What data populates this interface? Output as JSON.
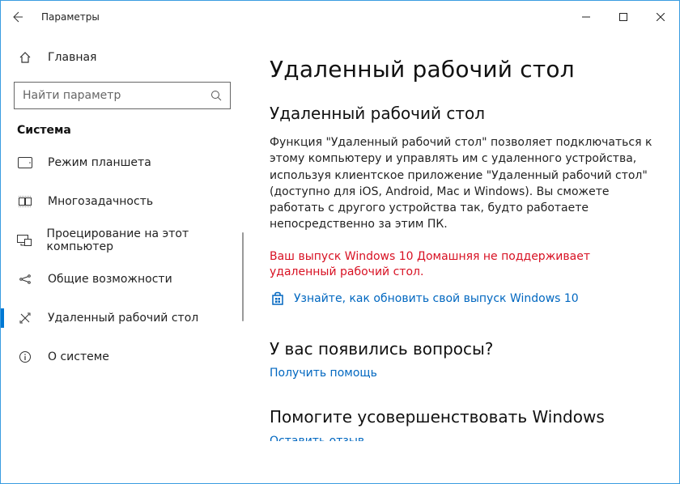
{
  "titlebar": {
    "app_title": "Параметры"
  },
  "sidebar": {
    "home_label": "Главная",
    "search_placeholder": "Найти параметр",
    "group_label": "Система",
    "items": [
      {
        "label": "Режим планшета"
      },
      {
        "label": "Многозадачность"
      },
      {
        "label": "Проецирование на этот компьютер"
      },
      {
        "label": "Общие возможности"
      },
      {
        "label": "Удаленный рабочий стол"
      },
      {
        "label": "О системе"
      }
    ]
  },
  "main": {
    "page_title": "Удаленный рабочий стол",
    "section_title": "Удаленный рабочий стол",
    "description": "Функция \"Удаленный рабочий стол\" позволяет подключаться к этому компьютеру и управлять им с удаленного устройства, используя клиентское приложение \"Удаленный рабочий стол\" (доступно для iOS, Android, Mac и Windows). Вы сможете работать с другого устройства так, будто работаете непосредственно за этим ПК.",
    "error_text": "Ваш выпуск Windows 10 Домашняя не поддерживает удаленный рабочий стол.",
    "upgrade_link": "Узнайте, как обновить свой выпуск Windows 10",
    "questions_title": "У вас появились вопросы?",
    "help_link": "Получить помощь",
    "improve_title": "Помогите усовершенствовать Windows",
    "feedback_link": "Оставить отзыв"
  }
}
